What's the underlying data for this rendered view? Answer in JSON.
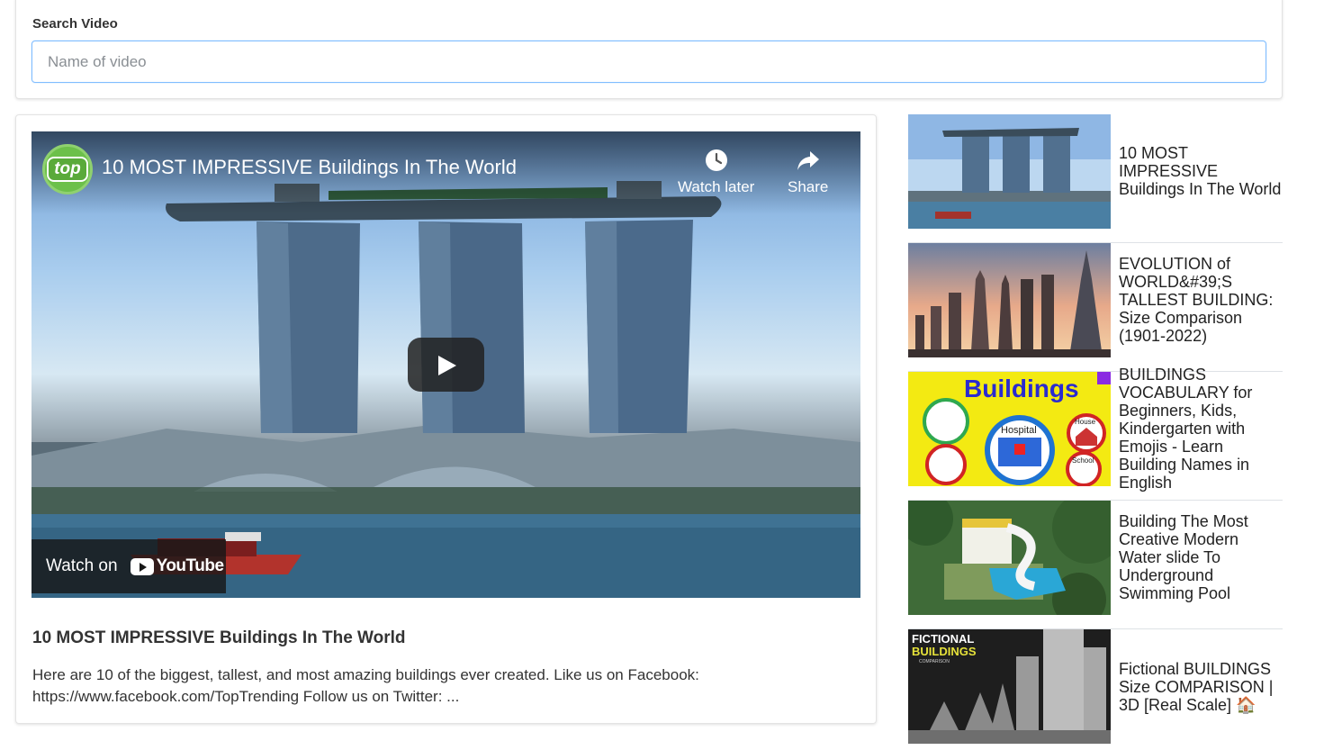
{
  "search": {
    "label": "Search Video",
    "placeholder": "Name of video"
  },
  "player": {
    "title": "10 MOST IMPRESSIVE Buildings In The World",
    "channel_logo_text": "top",
    "watch_later_label": "Watch later",
    "share_label": "Share",
    "watch_on_label": "Watch on",
    "youtube_label": "YouTube"
  },
  "video": {
    "title": "10 MOST IMPRESSIVE Buildings In The World",
    "description": "Here are 10 of the biggest, tallest, and most amazing buildings ever created. Like us on Facebook: https://www.facebook.com/TopTrending Follow us on Twitter: ..."
  },
  "related": [
    {
      "title": "10 MOST IMPRESSIVE Buildings In The World"
    },
    {
      "title": "EVOLUTION of WORLD&#39;S TALLEST BUILDING: Size Comparison (1901-2022)"
    },
    {
      "title": "BUILDINGS VOCABULARY for Beginners, Kids, Kindergarten with Emojis - Learn Building Names in English",
      "thumb_heading": "Buildings",
      "thumb_labels": [
        "Hospital",
        "House",
        "School"
      ]
    },
    {
      "title": "Building The Most Creative Modern Water slide To Underground Swimming Pool"
    },
    {
      "title": "Fictional BUILDINGS Size COMPARISON | 3D [Real Scale] 🏠",
      "thumb_heading_1": "FICTIONAL",
      "thumb_heading_2": "BUILDINGS",
      "thumb_subheading": "COMPARISON"
    }
  ]
}
